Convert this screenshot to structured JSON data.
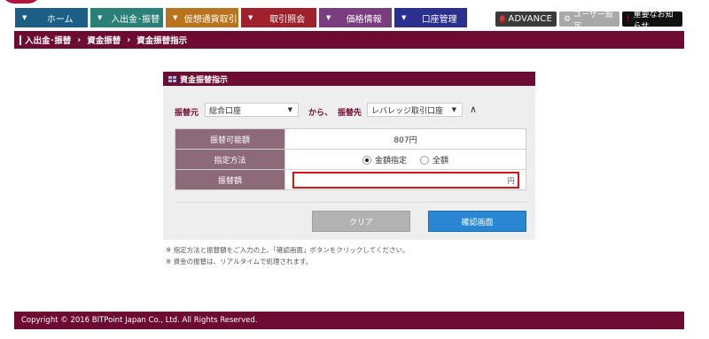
{
  "nav": {
    "tabs": [
      {
        "label": "ホーム"
      },
      {
        "label": "入出金･振替"
      },
      {
        "label": "仮想通貨取引"
      },
      {
        "label": "取引照会"
      },
      {
        "label": "価格情報"
      },
      {
        "label": "口座管理"
      }
    ]
  },
  "header_buttons": {
    "advance": "ADVANCE",
    "user_settings": "ユーザー設定",
    "notice": "重要なお知らせ"
  },
  "breadcrumb": {
    "items": [
      "入出金･振替",
      "資金振替",
      "資金振替指示"
    ],
    "separator": "›"
  },
  "panel": {
    "title": "資金振替指示",
    "from_label": "振替元",
    "from_value": "総合口座",
    "kara_text": "から、",
    "to_label": "振替先",
    "to_value": "レバレッジ取引口座",
    "rows": {
      "available_label": "振替可能額",
      "available_value": "807円",
      "method_label": "指定方法",
      "method_option_amount": "金額指定",
      "method_option_all": "全額",
      "amount_label": "振替額",
      "amount_value": "",
      "amount_unit": "円"
    },
    "clear_button": "クリア",
    "confirm_button": "確認画面"
  },
  "notes": [
    "※ 指定方法と振替額をご入力の上、「確認画面」ボタンをクリックしてください。",
    "※ 資金の振替は、リアルタイムで処理されます。"
  ],
  "footer": {
    "copyright": "Copyright © 2016 BITPoint Japan Co., Ltd. All Rights Reserved."
  },
  "colors": {
    "brand": "#6e0b32",
    "confirm": "#2a86d2",
    "clear": "#b2b2b2",
    "highlight": "#d21414"
  }
}
